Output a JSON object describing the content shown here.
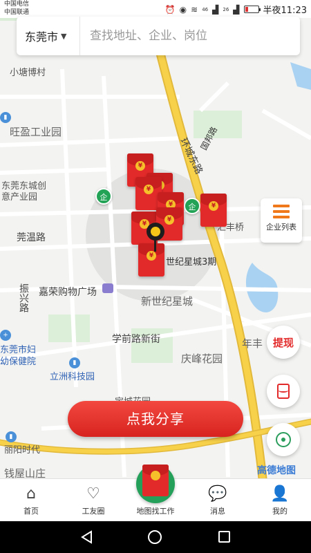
{
  "status_bar": {
    "carrier1": "中国电信",
    "carrier2": "中国联通",
    "network1": "46",
    "network2": "26",
    "time": "半夜11:23",
    "battery_level": 0.15
  },
  "search": {
    "city": "东莞市",
    "placeholder": "查找地址、企业、岗位"
  },
  "map": {
    "labels": {
      "xiaotang": "小塘博村",
      "wangying": "旺盈工业园",
      "dongcheng": "东莞东城创",
      "dongcheng2": "意产业园",
      "guanwen": "莞温路",
      "huancheng": "环城东路",
      "guobang": "国邦路",
      "huiju": "汇丰桥",
      "century3": "世纪星城3期",
      "jiarong": "嘉荣购物广场",
      "xinshiji": "新世纪星城",
      "zhenxing": "振兴路",
      "dgfu1": "东莞市妇",
      "dgfu2": "幼保健院",
      "xueqian": "学前路新街",
      "qingfeng": "庆峰花园",
      "lizhou": "立洲科技园",
      "baocheng": "宝城花园",
      "liyang": "丽阳时代",
      "qianwu": "钱屋山庄",
      "niansheng": "年丰",
      "amap": "高德地图"
    },
    "enterprise_marker": "企"
  },
  "right_panel": {
    "enterprise_list": "企业列表",
    "withdraw": "提现"
  },
  "share_button": "点我分享",
  "tabs": [
    {
      "label": "首页",
      "icon": "home-icon"
    },
    {
      "label": "工友圈",
      "icon": "heart-icon"
    },
    {
      "label": "地图找工作",
      "icon": "red-envelope-icon"
    },
    {
      "label": "消息",
      "icon": "chat-icon"
    },
    {
      "label": "我的",
      "icon": "person-icon"
    }
  ],
  "colors": {
    "accent_red": "#e32a2a",
    "map_road_yellow": "#f5c518",
    "enterprise_green": "#22a356",
    "list_orange": "#f07a1b"
  }
}
